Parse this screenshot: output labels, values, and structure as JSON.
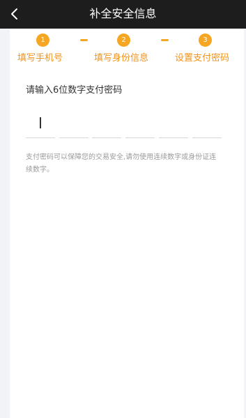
{
  "header": {
    "title": "补全安全信息"
  },
  "steps": [
    {
      "number": "1",
      "label": "填写手机号"
    },
    {
      "number": "2",
      "label": "填写身份信息"
    },
    {
      "number": "3",
      "label": "设置支付密码"
    }
  ],
  "form": {
    "prompt": "请输入6位数字支付密码",
    "hint": "支付密码可以保障您的交易安全,请勿使用连续数字或身份证连续数字。"
  },
  "colors": {
    "accent": "#f5a623",
    "header_bg": "#1d1d1d"
  }
}
